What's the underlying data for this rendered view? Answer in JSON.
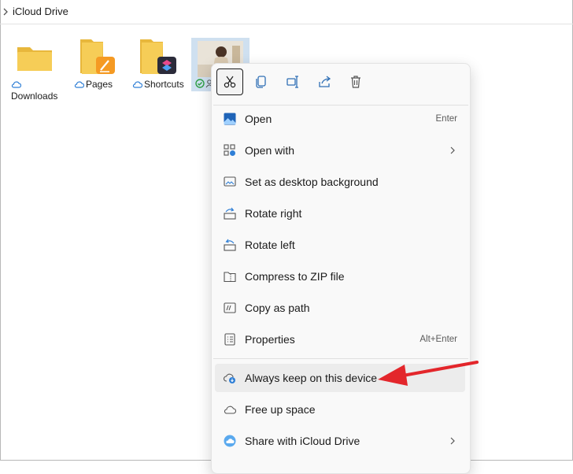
{
  "address_bar": {
    "path": "iCloud Drive"
  },
  "files": [
    {
      "name": "Downloads",
      "type": "folder",
      "sync_status": "cloud-icon"
    },
    {
      "name": "Pages",
      "type": "folder-with-app",
      "sync_status": "cloud-icon"
    },
    {
      "name": "Shortcuts",
      "type": "folder-with-app",
      "sync_status": "cloud-icon"
    },
    {
      "name": "",
      "type": "image-selected",
      "sync_status": "available-check-icon"
    }
  ],
  "context_menu": {
    "toolbar": [
      "cut-icon",
      "copy-icon",
      "rename-icon",
      "share-icon",
      "delete-icon"
    ],
    "items": [
      {
        "label": "Open",
        "shortcut": "Enter"
      },
      {
        "label": "Open with",
        "submenu": true
      },
      {
        "label": "Set as desktop background"
      },
      {
        "label": "Rotate right"
      },
      {
        "label": "Rotate left"
      },
      {
        "label": "Compress to ZIP file"
      },
      {
        "label": "Copy as path"
      },
      {
        "label": "Properties",
        "shortcut": "Alt+Enter"
      },
      {
        "label": "Always keep on this device",
        "highlighted": true
      },
      {
        "label": "Free up space"
      },
      {
        "label": "Share with iCloud Drive",
        "submenu": true
      }
    ]
  },
  "colors": {
    "accent_blue": "#2f7fd6",
    "folder_yellow": "#f2c94c",
    "annotation_red": "#e3262b",
    "menu_bg": "#f9f9f9"
  }
}
